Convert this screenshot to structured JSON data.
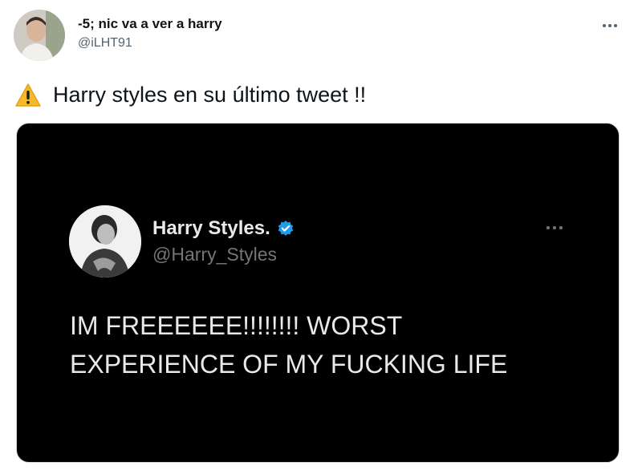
{
  "tweet": {
    "author": {
      "display_name": "-5; nic va a ver a harry",
      "handle": "@iLHT91"
    },
    "more_icon": "more-horizontal-icon",
    "text": "Harry styles en su último tweet !!",
    "leading_emoji": "warning-icon"
  },
  "embedded": {
    "author": {
      "display_name": "Harry Styles.",
      "handle": "@Harry_Styles",
      "verified": true
    },
    "text_line1": "IM FREEEEEE!!!!!!!! WORST",
    "text_line2": "EXPERIENCE OF MY FUCKING LIFE",
    "background": "#000000"
  },
  "colors": {
    "verified_blue": "#1d9bf0",
    "warning_yellow": "#f7b928"
  }
}
